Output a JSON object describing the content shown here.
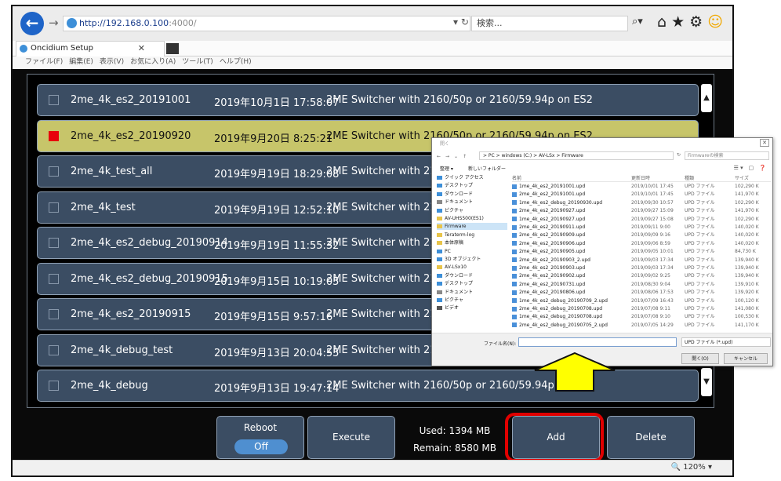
{
  "browser": {
    "url_host": "http://192.168.0.100",
    "url_port": ":4000/",
    "search_placeholder": "検索...",
    "tab_title": "Oncidium Setup",
    "menu": [
      "ファイル(F)",
      "編集(E)",
      "表示(V)",
      "お気に入り(A)",
      "ツール(T)",
      "ヘルプ(H)"
    ],
    "zoom": "120%"
  },
  "files": [
    {
      "name": "2me_4k_es2_20191001",
      "date": "2019年10月1日 17:58:07",
      "desc": "2ME Switcher with 2160/50p or 2160/59.94p on ES2",
      "selected": false
    },
    {
      "name": "2me_4k_es2_20190920",
      "date": "2019年9月20日 8:25:21",
      "desc": "2ME Switcher with 2160/50p or 2160/59.94p on ES2",
      "selected": true
    },
    {
      "name": "2me_4k_test_all",
      "date": "2019年9月19日 18:29:08",
      "desc": "2ME Switcher with 2160/5",
      "selected": false
    },
    {
      "name": "2me_4k_test",
      "date": "2019年9月19日 12:52:10",
      "desc": "2ME Switcher with 2160/5",
      "selected": false
    },
    {
      "name": "2me_4k_es2_debug_20190914",
      "date": "2019年9月19日 11:55:32",
      "desc": "2ME Switcher with 2160/5",
      "selected": false
    },
    {
      "name": "2me_4k_es2_debug_20190915",
      "date": "2019年9月15日 10:19:05",
      "desc": "2ME Switcher with 2160/5",
      "selected": false
    },
    {
      "name": "2me_4k_es2_20190915",
      "date": "2019年9月15日 9:57:16",
      "desc": "2ME Switcher with 2160/5",
      "selected": false
    },
    {
      "name": "2me_4k_debug_test",
      "date": "2019年9月13日 20:04:55",
      "desc": "2ME Switcher with 2160/5",
      "selected": false
    },
    {
      "name": "2me_4k_debug",
      "date": "2019年9月13日 19:47:14",
      "desc": "2ME Switcher with 2160/50p or 2160/59.94p on ES2",
      "selected": false
    }
  ],
  "controls": {
    "reboot_label": "Reboot",
    "reboot_state": "Off",
    "execute_label": "Execute",
    "used": "Used: 1394 MB",
    "remain": "Remain: 8580 MB",
    "add_label": "Add",
    "delete_label": "Delete"
  },
  "dialog": {
    "title": "開く",
    "path": "> PC > windows (C:) > AV-LSx > Firmware",
    "search_placeholder": "Firmwareの検索",
    "organize": "整理 ▾",
    "new_folder": "新しいフォルダー",
    "nav_items": [
      {
        "label": "クイック アクセス",
        "color": "#3d8fd8",
        "selected": false
      },
      {
        "label": "デスクトップ",
        "color": "#3d8fd8",
        "selected": false
      },
      {
        "label": "ダウンロード",
        "color": "#3d8fd8",
        "selected": false
      },
      {
        "label": "ドキュメント",
        "color": "#888888",
        "selected": false
      },
      {
        "label": "ピクチャ",
        "color": "#3d8fd8",
        "selected": false
      },
      {
        "label": "AV-UHS500(ES1)",
        "color": "#e8c44a",
        "selected": false
      },
      {
        "label": "Firmware",
        "color": "#e8c44a",
        "selected": true
      },
      {
        "label": "Teraterm-log",
        "color": "#e8c44a",
        "selected": false
      },
      {
        "label": "本体原稿",
        "color": "#e8c44a",
        "selected": false
      },
      {
        "label": "PC",
        "color": "#3d8fd8",
        "selected": false
      },
      {
        "label": "3D オブジェクト",
        "color": "#3d8fd8",
        "selected": false
      },
      {
        "label": "AV-LSx10",
        "color": "#e8c44a",
        "selected": false
      },
      {
        "label": "ダウンロード",
        "color": "#3d8fd8",
        "selected": false
      },
      {
        "label": "デスクトップ",
        "color": "#3d8fd8",
        "selected": false
      },
      {
        "label": "ドキュメント",
        "color": "#888888",
        "selected": false
      },
      {
        "label": "ピクチャ",
        "color": "#3d8fd8",
        "selected": false
      },
      {
        "label": "ビデオ",
        "color": "#555555",
        "selected": false
      }
    ],
    "headers": {
      "name": "名前",
      "modified": "更新日時",
      "type": "種類",
      "size": "サイズ"
    },
    "files": [
      {
        "name": "1me_4k_es2_20191001.upd",
        "date": "2019/10/01 17:45",
        "type": "UPD ファイル",
        "size": "102,290 K"
      },
      {
        "name": "2me_4k_es2_20191001.upd",
        "date": "2019/10/01 17:45",
        "type": "UPD ファイル",
        "size": "141,970 K"
      },
      {
        "name": "1me_4k_es2_debug_20190930.upd",
        "date": "2019/09/30 10:57",
        "type": "UPD ファイル",
        "size": "102,290 K"
      },
      {
        "name": "2me_4k_es2_20190927.upd",
        "date": "2019/09/27 15:09",
        "type": "UPD ファイル",
        "size": "141,970 K"
      },
      {
        "name": "1me_4k_es2_20190927.upd",
        "date": "2019/09/27 15:08",
        "type": "UPD ファイル",
        "size": "102,290 K"
      },
      {
        "name": "2me_4k_es2_20190911.upd",
        "date": "2019/09/11 9:00",
        "type": "UPD ファイル",
        "size": "140,020 K"
      },
      {
        "name": "2me_4k_es2_20190909.upd",
        "date": "2019/09/09 9:16",
        "type": "UPD ファイル",
        "size": "140,020 K"
      },
      {
        "name": "2me_4k_es2_20190906.upd",
        "date": "2019/09/06 8:59",
        "type": "UPD ファイル",
        "size": "140,020 K"
      },
      {
        "name": "2me_4k_es2_20190905.upd",
        "date": "2019/09/05 10:01",
        "type": "UPD ファイル",
        "size": "84,730 K"
      },
      {
        "name": "2me_4k_es2_20190903_2.upd",
        "date": "2019/09/03 17:34",
        "type": "UPD ファイル",
        "size": "139,940 K"
      },
      {
        "name": "2me_4k_es2_20190903.upd",
        "date": "2019/09/03 17:34",
        "type": "UPD ファイル",
        "size": "139,940 K"
      },
      {
        "name": "2me_4k_es2_20190902.upd",
        "date": "2019/09/02 9:25",
        "type": "UPD ファイル",
        "size": "139,940 K"
      },
      {
        "name": "2me_4k_es2_20190731.upd",
        "date": "2019/08/30 9:04",
        "type": "UPD ファイル",
        "size": "139,910 K"
      },
      {
        "name": "2me_4k_es2_20190806.upd",
        "date": "2019/08/06 17:53",
        "type": "UPD ファイル",
        "size": "139,920 K"
      },
      {
        "name": "1me_4k_es2_debug_20190709_2.upd",
        "date": "2019/07/09 16:43",
        "type": "UPD ファイル",
        "size": "100,120 K"
      },
      {
        "name": "2me_4k_es2_debug_20190708.upd",
        "date": "2019/07/08 9:11",
        "type": "UPD ファイル",
        "size": "141,080 K"
      },
      {
        "name": "1me_4k_es2_debug_20190708.upd",
        "date": "2019/07/08 9:10",
        "type": "UPD ファイル",
        "size": "100,530 K"
      },
      {
        "name": "2me_4k_es2_debug_20190705_2.upd",
        "date": "2019/07/05 14:29",
        "type": "UPD ファイル",
        "size": "141,170 K"
      }
    ],
    "filename_label": "ファイル名(N):",
    "filetype": "UPD ファイル (*.upd)",
    "open_label": "開く(O)",
    "cancel_label": "キャンセル"
  },
  "colors": {
    "row_bg": "#3b4d63",
    "row_selected_bg": "#c7c56a",
    "checkbox_selected": "#e8000b",
    "highlight_border": "#e00000",
    "arrow_fill": "#ffff00"
  }
}
